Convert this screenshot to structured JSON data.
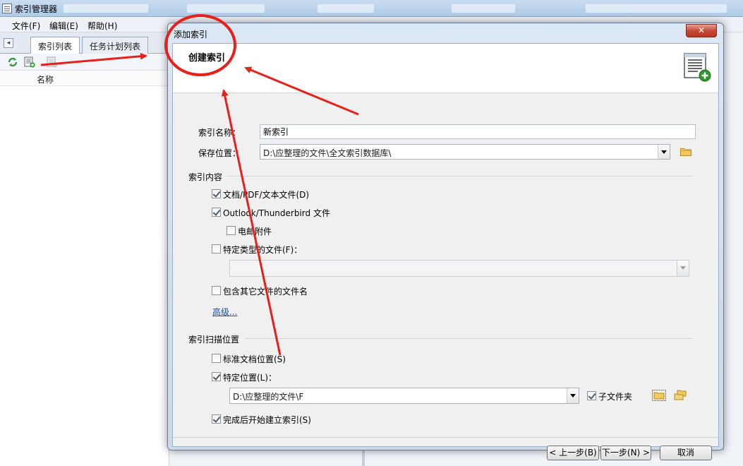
{
  "app": {
    "title": "索引管理器",
    "menu": [
      "文件(F)",
      "编辑(E)",
      "帮助(H)"
    ],
    "tabs": [
      "索引列表",
      "任务计划列表"
    ],
    "list_header": "名称"
  },
  "dialog": {
    "title": "添加索引",
    "close_label": "✕",
    "heading": "创建索引",
    "index_name_label": "索引名称：",
    "index_name_value": "新索引",
    "save_location_label": "保存位置：",
    "save_location_value": "D:\\应整理的文件\\全文索引数据库\\",
    "content_section": "索引内容",
    "opt_documents": "文档/PDF/文本文件(D)",
    "opt_outlook": "Outlook/Thunderbird 文件",
    "opt_attachments": "电邮附件",
    "opt_specific_types": "特定类型的文件(F)：",
    "opt_other_names": "包含其它文件的文件名",
    "advanced_link": "高级...",
    "scan_section": "索引扫描位置",
    "opt_standard_location": "标准文档位置(S)",
    "opt_specific_location": "特定位置(L)：",
    "specific_location_value": "D:\\应整理的文件\\F",
    "opt_subfolders": "子文件夹",
    "opt_build_after": "完成后开始建立索引(S)",
    "btn_back": "< 上一步(B)",
    "btn_next": "下一步(N) >",
    "btn_cancel": "取消"
  },
  "checks": {
    "documents": true,
    "outlook": true,
    "attachments": false,
    "specific_types": false,
    "other_names": false,
    "standard_location": false,
    "specific_location": true,
    "subfolders": true,
    "build_after": true
  },
  "colors": {
    "annotation": "#e8201a",
    "link": "#1c4fa8",
    "close_button": "#c74a38"
  }
}
